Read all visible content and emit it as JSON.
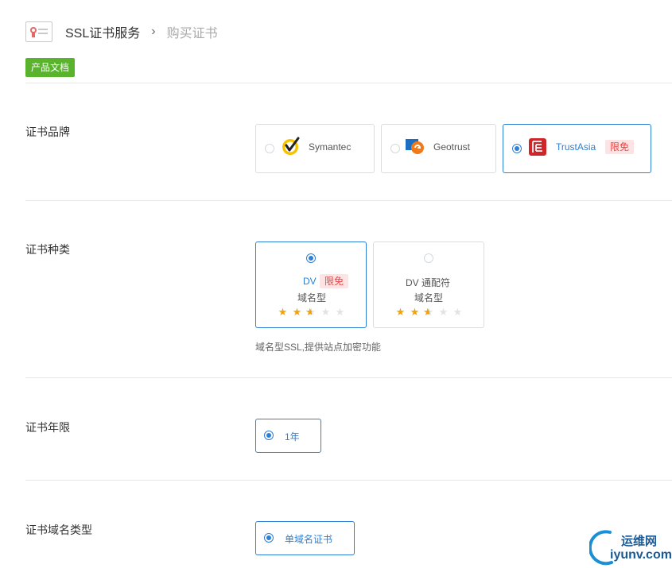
{
  "header": {
    "crumb_main": "SSL证书服务",
    "crumb_sep": "›",
    "crumb_current": "购买证书"
  },
  "doc_button": "产品文档",
  "brand": {
    "label": "证书品牌",
    "options": [
      {
        "name": "Symantec",
        "selected": false,
        "icon": "symantec-check-icon"
      },
      {
        "name": "Geotrust",
        "selected": false,
        "icon": "geotrust-logo-icon"
      },
      {
        "name": "TrustAsia",
        "selected": true,
        "icon": "trustasia-logo-icon",
        "tag": "限免"
      }
    ]
  },
  "type": {
    "label": "证书种类",
    "options": [
      {
        "name": "DV",
        "tag": "限免",
        "sub": "域名型",
        "rating": 2.5,
        "selected": true
      },
      {
        "name": "DV 通配符",
        "sub": "域名型",
        "rating": 2.5,
        "selected": false
      }
    ],
    "description": "域名型SSL,提供站点加密功能"
  },
  "years": {
    "label": "证书年限",
    "option": "1年",
    "selected": true
  },
  "domain_type": {
    "label": "证书域名类型",
    "option": "单域名证书",
    "selected": true
  },
  "watermark": {
    "line1": "运维网",
    "line2": "iyunv.com"
  },
  "colors": {
    "accent": "#2e7fd6",
    "doc_green": "#5ab32d",
    "tag_bg": "#fde3e3",
    "tag_text": "#e04a4a",
    "star": "#f0a30a"
  }
}
